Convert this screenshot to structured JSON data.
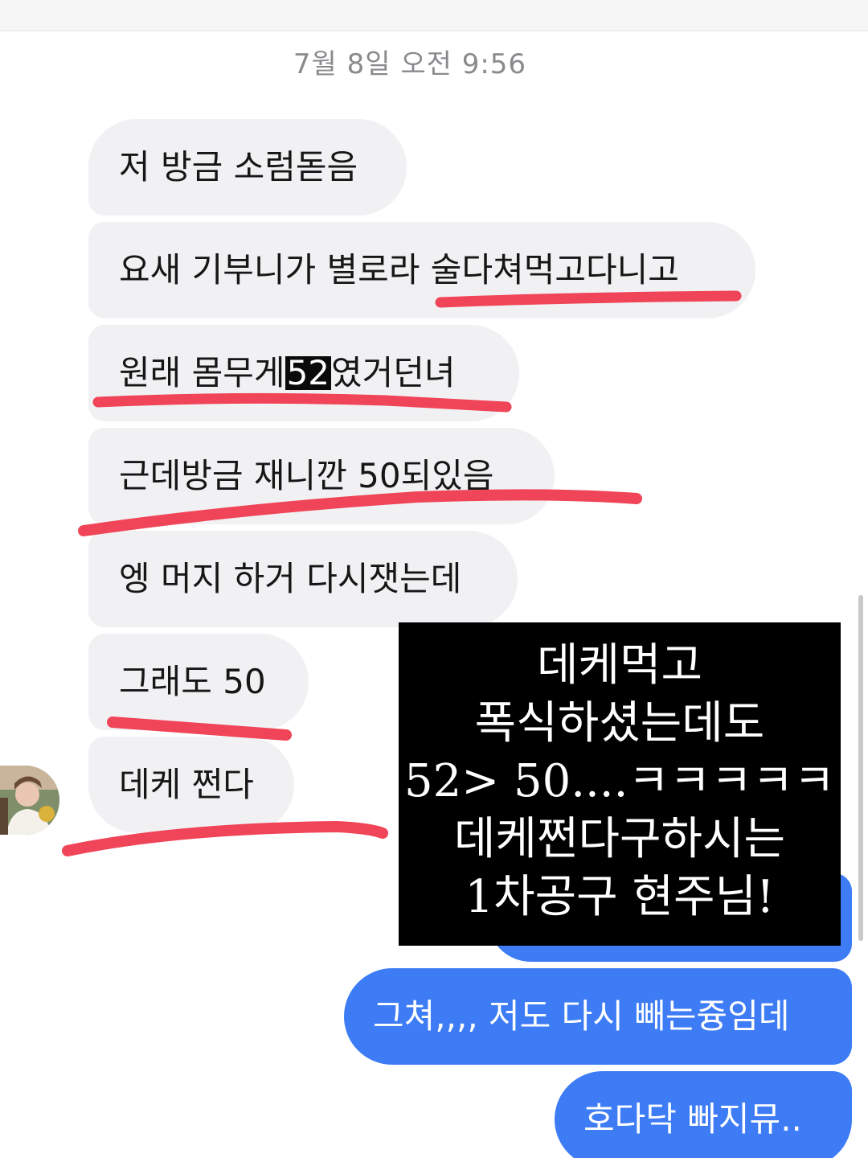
{
  "status_bar": {},
  "thread": {
    "timestamp": "7월 8일 오전 9:56",
    "received": [
      {
        "text": "저 방금 소럼돋음"
      },
      {
        "pre": "요새 기부니가 별로라 술다쳐먹고다니고"
      },
      {
        "pre": "원래 몸무게 ",
        "highlight": "52",
        "post": "였거던녀"
      },
      {
        "text": "근데방금 재니깐 50되있음"
      },
      {
        "text": "엥 머지 하거 다시잿는데"
      },
      {
        "text": "그래도 50"
      },
      {
        "text": "데케 쩐다"
      }
    ],
    "sent": [
      {
        "text": "그쳐,,,, 저도 다시 빼는즁임데"
      },
      {
        "text": "호다닥 빠지뮤.."
      }
    ]
  },
  "caption": {
    "lines": [
      "데케먹고",
      "폭식하셨는데도",
      "52> 50....ㅋㅋㅋㅋㅋ",
      "데케쩐다구하시는",
      "1차공구 현주님!"
    ]
  },
  "colors": {
    "received_bubble": "#f1f1f3",
    "sent_bubble": "#3d7cf5",
    "underline": "#f04458",
    "caption_bg": "#000000"
  }
}
